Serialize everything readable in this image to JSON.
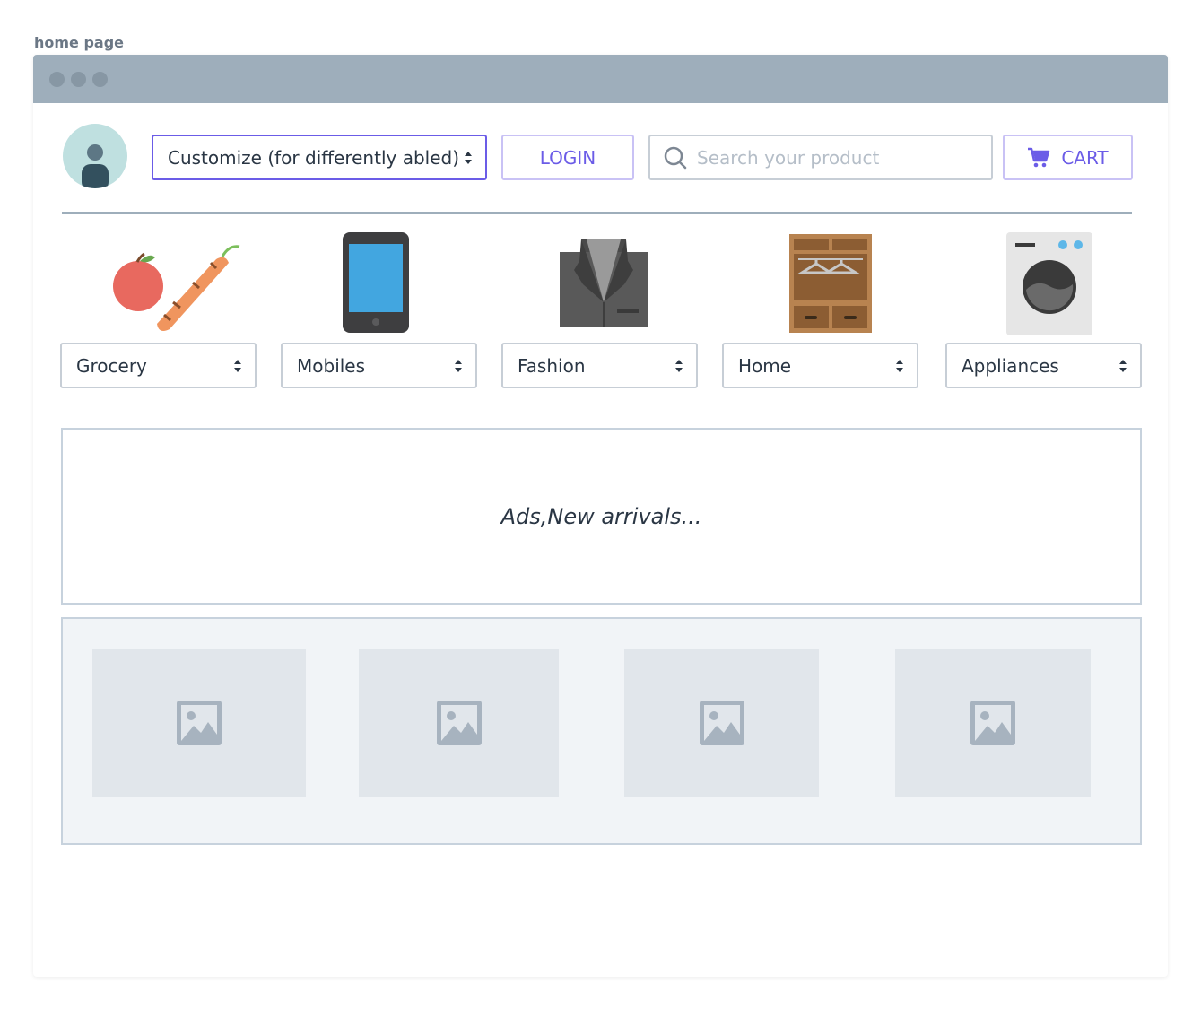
{
  "page_label": "home page",
  "header": {
    "accessibility_select": "Customize (for differently abled)",
    "login_label": "LOGIN",
    "search_placeholder": "Search your product",
    "cart_label": "CART"
  },
  "categories": [
    {
      "label": "Grocery",
      "icon": "grocery-icon"
    },
    {
      "label": "Mobiles",
      "icon": "mobile-phone-icon"
    },
    {
      "label": "Fashion",
      "icon": "suit-jacket-icon"
    },
    {
      "label": "Home",
      "icon": "wardrobe-icon"
    },
    {
      "label": "Appliances",
      "icon": "washing-machine-icon"
    }
  ],
  "ads": {
    "text": "Ads,New arrivals..."
  },
  "gallery": {
    "placeholders": 4,
    "icon": "image-placeholder-icon"
  },
  "colors": {
    "accent": "#6b5ce7",
    "titlebar": "#9eaebb",
    "border": "#c7ced6"
  }
}
